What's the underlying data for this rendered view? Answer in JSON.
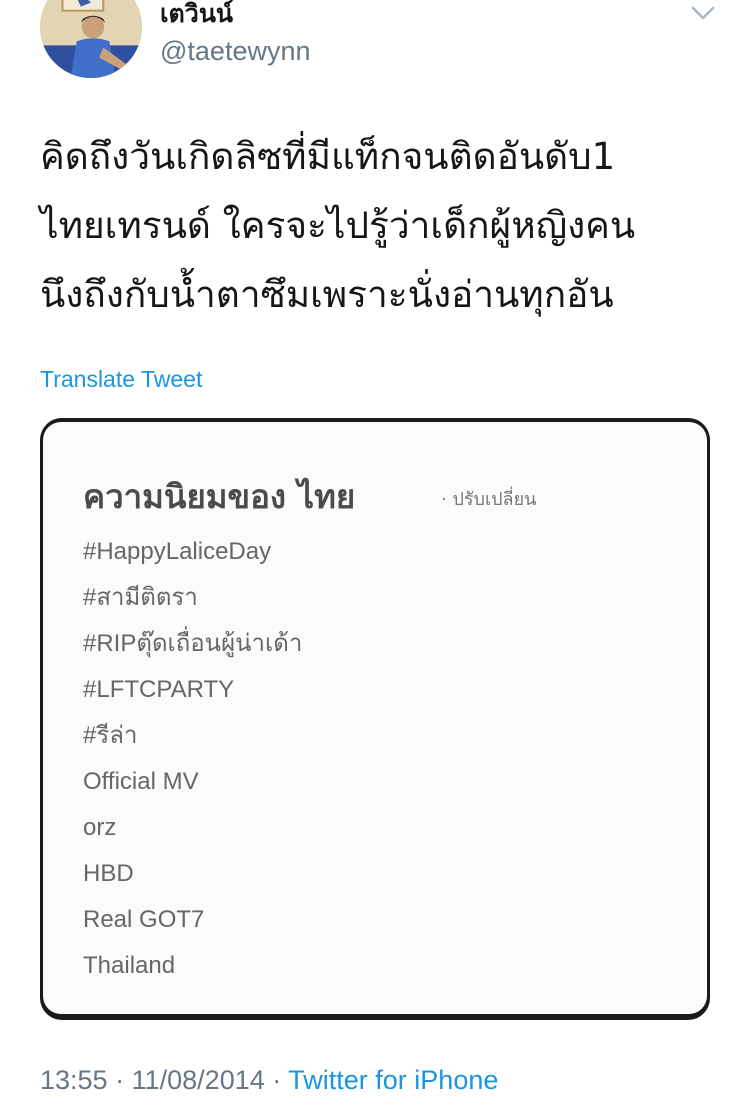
{
  "user": {
    "display_name": "เตวินน์",
    "handle": "@taetewynn"
  },
  "tweet": {
    "lines": [
      "คิดถึงวันเกิดลิซที่มีแท็กจนติดอันดับ1",
      "ไทยเทรนด์ ใครจะไปรู้ว่าเด็กผู้หญิงคน",
      "นึงถึงกับน้ำตาซึมเพราะนั่งอ่านทุกอัน"
    ],
    "translate_label": "Translate Tweet"
  },
  "media": {
    "title": "ความนิยมของ ไทย",
    "change_label": "· ปรับเปลี่ยน",
    "trends": [
      "#HappyLaliceDay",
      "#สามีติตรา",
      "#RIPตุ๊ดเถื่อนผู้น่าเด้า",
      "#LFTCPARTY",
      "#รีล่า",
      "Official MV",
      "orz",
      "HBD",
      "Real GOT7",
      "Thailand"
    ]
  },
  "meta": {
    "time": "13:55",
    "separator": "·",
    "date": "11/08/2014",
    "source": "Twitter for iPhone"
  },
  "colors": {
    "link": "#1b95e0",
    "secondary": "#657786",
    "text": "#14171a"
  },
  "icons": {
    "caret": "chevron-down-icon"
  }
}
